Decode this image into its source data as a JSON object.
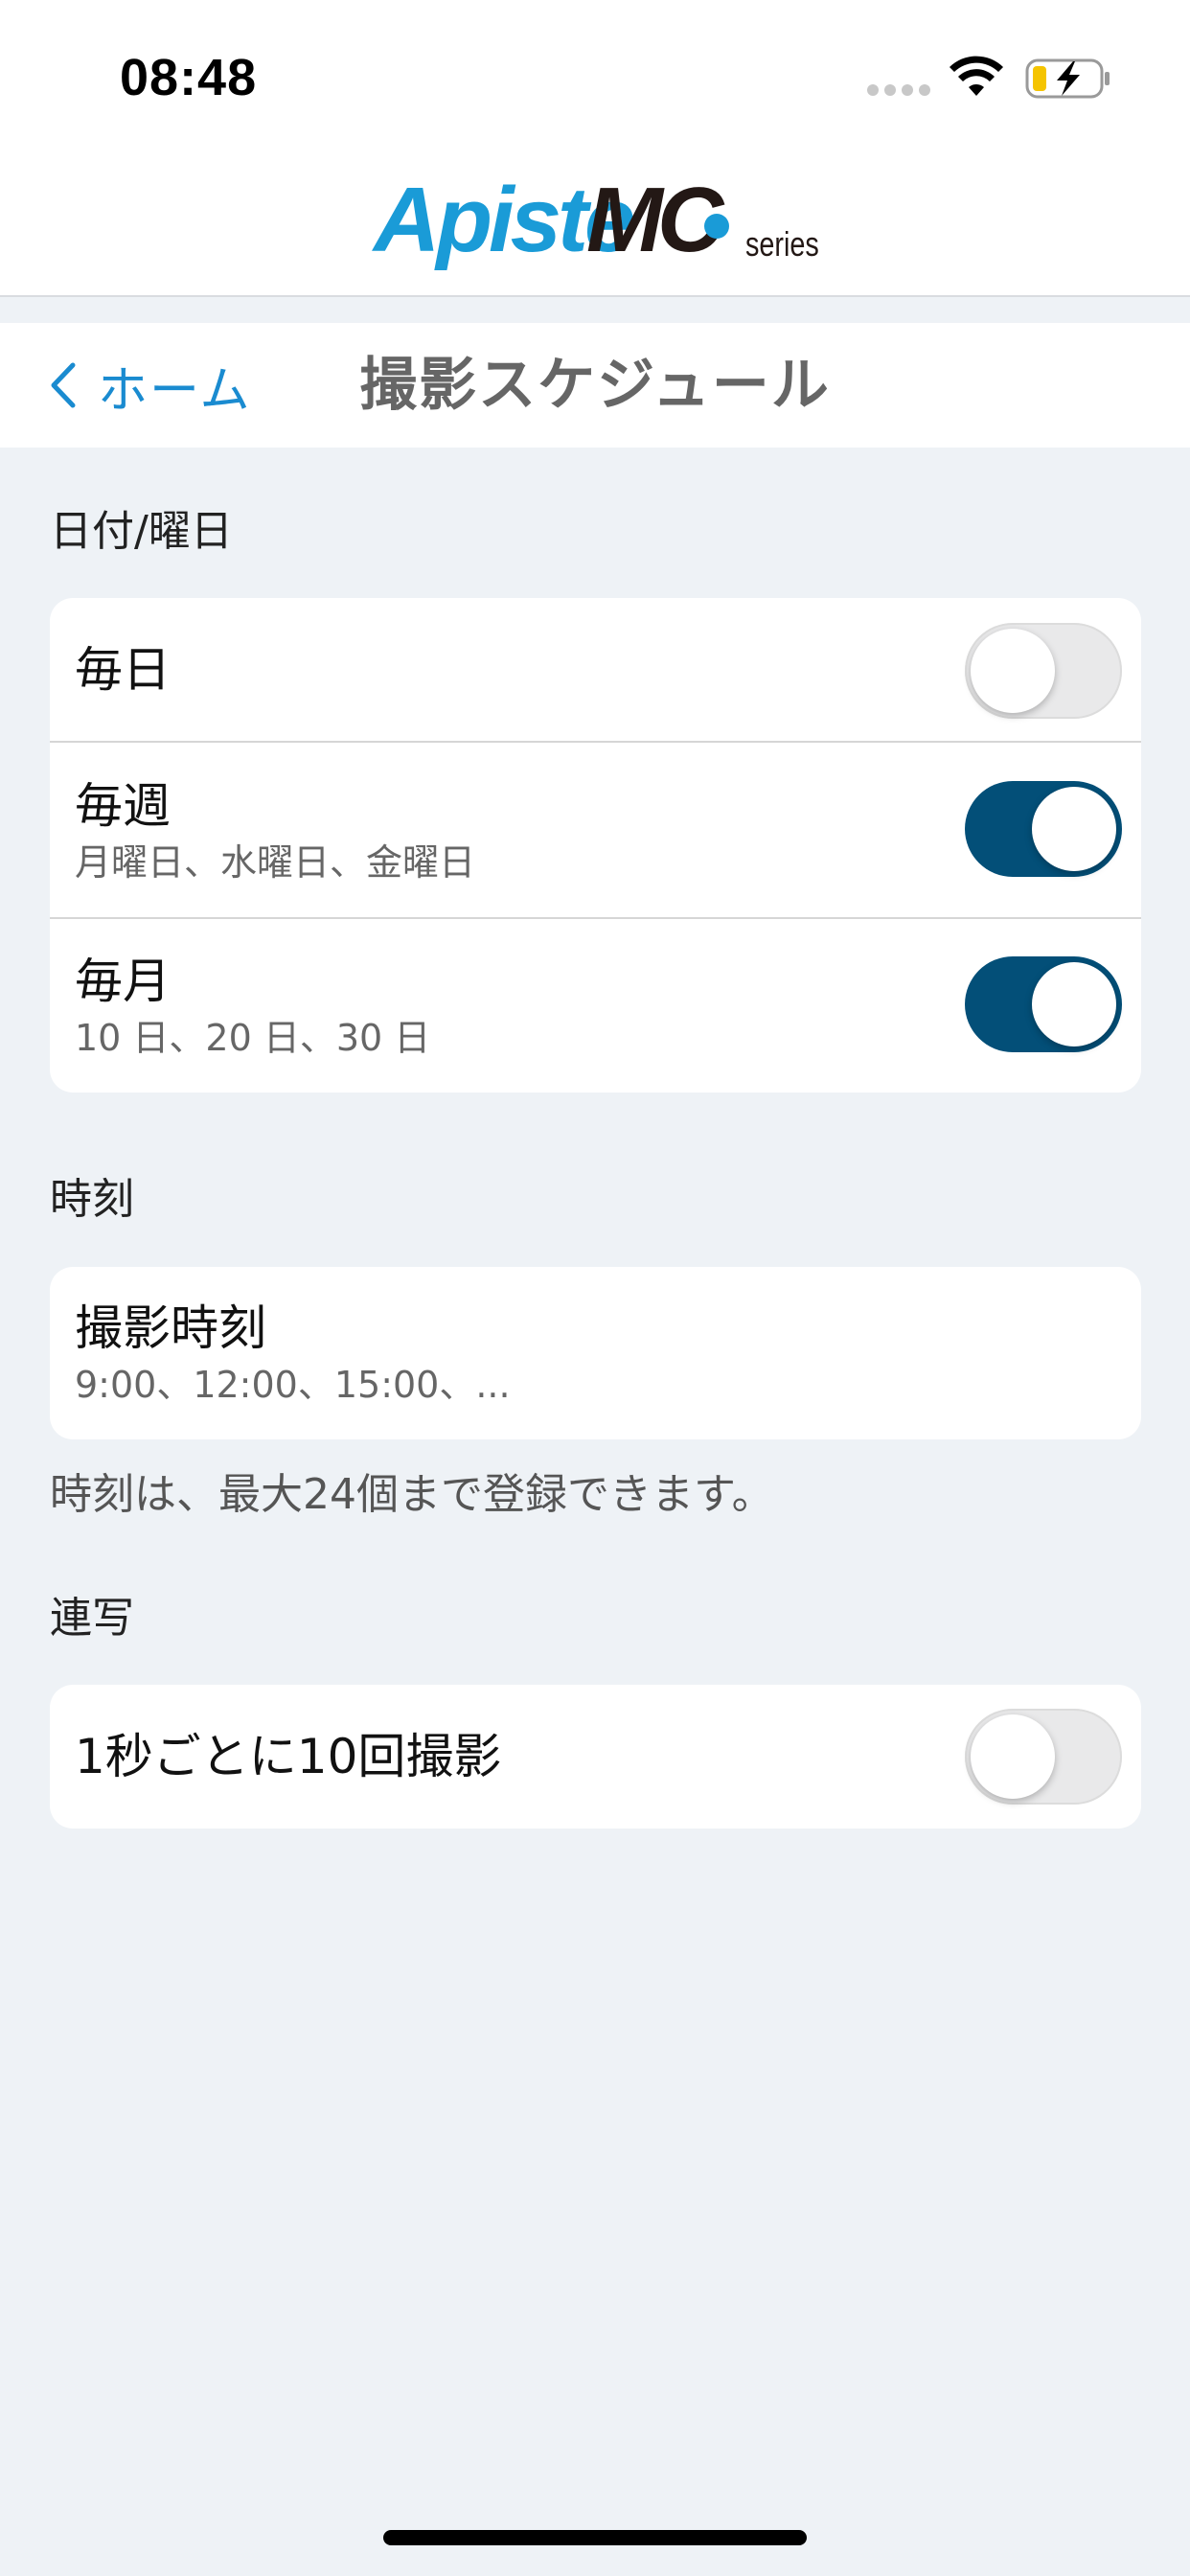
{
  "status_bar": {
    "time": "08:48",
    "icons": [
      "signal-dots-icon",
      "wifi-icon",
      "battery-charging-icon"
    ],
    "battery_color": "#f5c400"
  },
  "logo": {
    "brand_left": "Apiste",
    "brand_right": "MC",
    "suffix": "series",
    "colors": {
      "blue": "#1a9bd7",
      "dark": "#231815"
    }
  },
  "nav": {
    "back_label": "ホーム",
    "title": "撮影スケジュール",
    "accent": "#1a8bd0"
  },
  "date_section": {
    "header": "日付/曜日",
    "rows": [
      {
        "title": "毎日",
        "subtitle": "",
        "enabled": false
      },
      {
        "title": "毎週",
        "subtitle": "月曜日、水曜日、金曜日",
        "enabled": true
      },
      {
        "title": "毎月",
        "subtitle": "10 日、20 日、30 日",
        "enabled": true
      }
    ]
  },
  "time_section": {
    "header": "時刻",
    "row": {
      "title": "撮影時刻",
      "subtitle": "9:00、12:00、15:00、..."
    },
    "note": "時刻は、最大24個まで登録できます。"
  },
  "burst_section": {
    "header": "連写",
    "row": {
      "title": "1秒ごとに10回撮影",
      "enabled": false
    }
  },
  "toggle_on_color": "#034f78"
}
